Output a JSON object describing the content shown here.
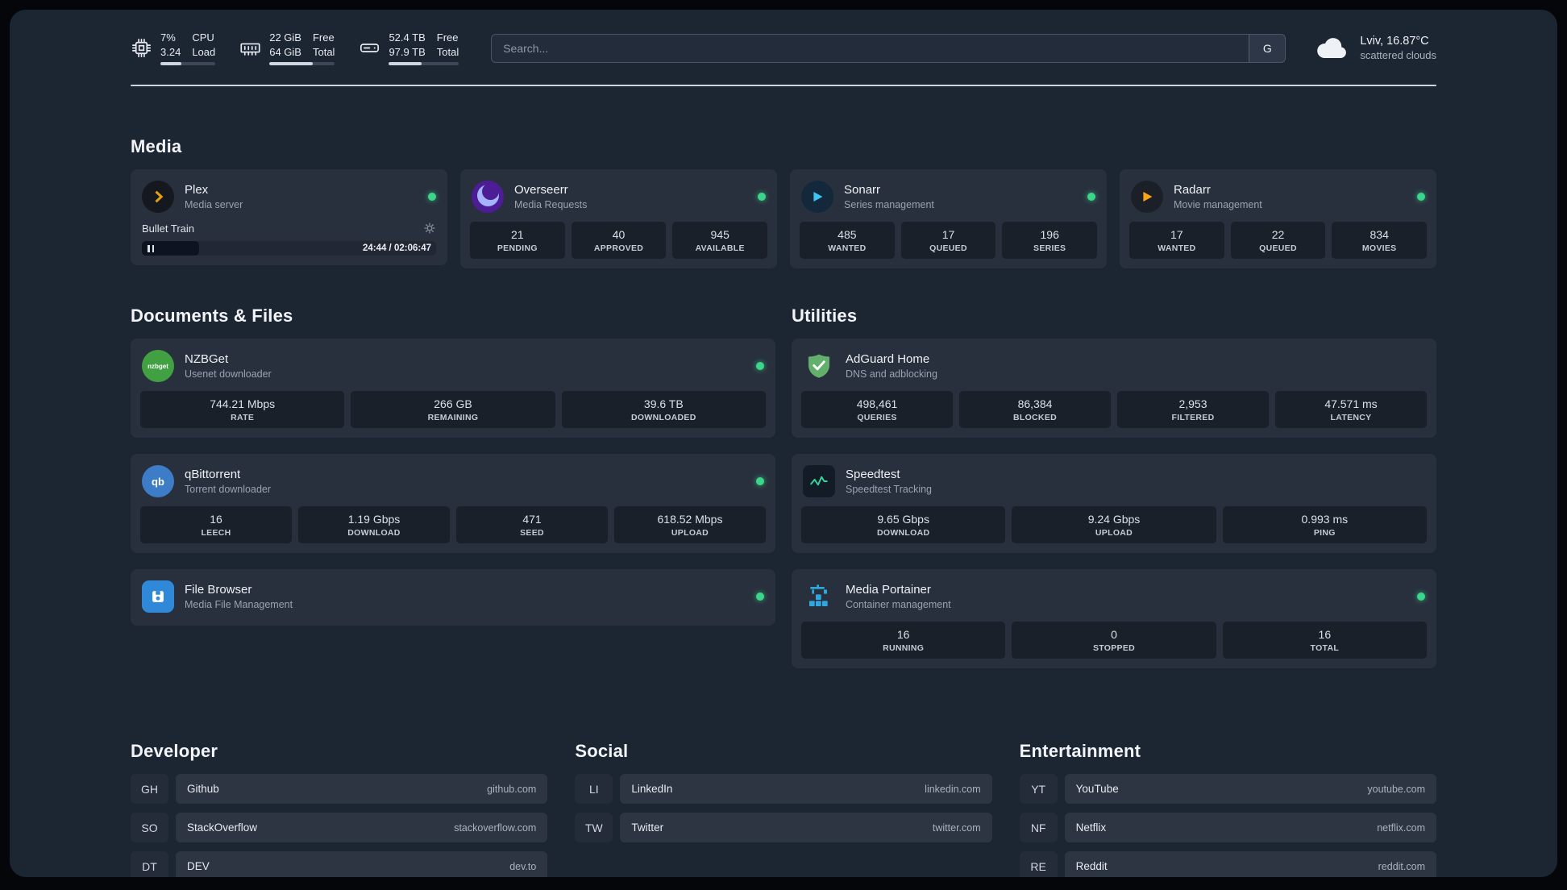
{
  "topbar": {
    "cpu": {
      "value_top": "7%",
      "value_bottom": "3.24",
      "label_top": "CPU",
      "label_bottom": "Load"
    },
    "memory": {
      "value_top": "22 GiB",
      "value_bottom": "64 GiB",
      "label_top": "Free",
      "label_bottom": "Total"
    },
    "disk": {
      "value_top": "52.4 TB",
      "value_bottom": "97.9 TB",
      "label_top": "Free",
      "label_bottom": "Total"
    },
    "search": {
      "placeholder": "Search...",
      "provider_label": "G"
    },
    "weather": {
      "location": "Lviv, 16.87°C",
      "condition": "scattered clouds"
    }
  },
  "sections": {
    "media": {
      "title": "Media",
      "plex": {
        "name": "Plex",
        "desc": "Media server",
        "now_playing": "Bullet Train",
        "time": "24:44 / 02:06:47"
      },
      "overseerr": {
        "name": "Overseerr",
        "desc": "Media Requests",
        "stats": [
          {
            "value": "21",
            "label": "PENDING"
          },
          {
            "value": "40",
            "label": "APPROVED"
          },
          {
            "value": "945",
            "label": "AVAILABLE"
          }
        ]
      },
      "sonarr": {
        "name": "Sonarr",
        "desc": "Series management",
        "stats": [
          {
            "value": "485",
            "label": "WANTED"
          },
          {
            "value": "17",
            "label": "QUEUED"
          },
          {
            "value": "196",
            "label": "SERIES"
          }
        ]
      },
      "radarr": {
        "name": "Radarr",
        "desc": "Movie management",
        "stats": [
          {
            "value": "17",
            "label": "WANTED"
          },
          {
            "value": "22",
            "label": "QUEUED"
          },
          {
            "value": "834",
            "label": "MOVIES"
          }
        ]
      }
    },
    "documents": {
      "title": "Documents & Files",
      "nzbget": {
        "name": "NZBGet",
        "desc": "Usenet downloader",
        "icon_text": "nzbget",
        "stats": [
          {
            "value": "744.21 Mbps",
            "label": "RATE"
          },
          {
            "value": "266 GB",
            "label": "REMAINING"
          },
          {
            "value": "39.6 TB",
            "label": "DOWNLOADED"
          }
        ]
      },
      "qbittorrent": {
        "name": "qBittorrent",
        "desc": "Torrent downloader",
        "icon_text": "qb",
        "stats": [
          {
            "value": "16",
            "label": "LEECH"
          },
          {
            "value": "1.19 Gbps",
            "label": "DOWNLOAD"
          },
          {
            "value": "471",
            "label": "SEED"
          },
          {
            "value": "618.52 Mbps",
            "label": "UPLOAD"
          }
        ]
      },
      "filebrowser": {
        "name": "File Browser",
        "desc": "Media File Management"
      }
    },
    "utilities": {
      "title": "Utilities",
      "adguard": {
        "name": "AdGuard Home",
        "desc": "DNS and adblocking",
        "stats": [
          {
            "value": "498,461",
            "label": "QUERIES"
          },
          {
            "value": "86,384",
            "label": "BLOCKED"
          },
          {
            "value": "2,953",
            "label": "FILTERED"
          },
          {
            "value": "47.571 ms",
            "label": "LATENCY"
          }
        ]
      },
      "speedtest": {
        "name": "Speedtest",
        "desc": "Speedtest Tracking",
        "stats": [
          {
            "value": "9.65 Gbps",
            "label": "DOWNLOAD"
          },
          {
            "value": "9.24 Gbps",
            "label": "UPLOAD"
          },
          {
            "value": "0.993 ms",
            "label": "PING"
          }
        ]
      },
      "portainer": {
        "name": "Media Portainer",
        "desc": "Container management",
        "stats": [
          {
            "value": "16",
            "label": "RUNNING"
          },
          {
            "value": "0",
            "label": "STOPPED"
          },
          {
            "value": "16",
            "label": "TOTAL"
          }
        ]
      }
    }
  },
  "bookmarks": {
    "developer": {
      "title": "Developer",
      "items": [
        {
          "abbr": "GH",
          "name": "Github",
          "url": "github.com"
        },
        {
          "abbr": "SO",
          "name": "StackOverflow",
          "url": "stackoverflow.com"
        },
        {
          "abbr": "DT",
          "name": "DEV",
          "url": "dev.to"
        }
      ]
    },
    "social": {
      "title": "Social",
      "items": [
        {
          "abbr": "LI",
          "name": "LinkedIn",
          "url": "linkedin.com"
        },
        {
          "abbr": "TW",
          "name": "Twitter",
          "url": "twitter.com"
        }
      ]
    },
    "entertainment": {
      "title": "Entertainment",
      "items": [
        {
          "abbr": "YT",
          "name": "YouTube",
          "url": "youtube.com"
        },
        {
          "abbr": "NF",
          "name": "Netflix",
          "url": "netflix.com"
        },
        {
          "abbr": "RE",
          "name": "Reddit",
          "url": "reddit.com"
        }
      ]
    }
  },
  "colors": {
    "status_online": "#3bd689",
    "plex_accent": "#e5a00d"
  }
}
